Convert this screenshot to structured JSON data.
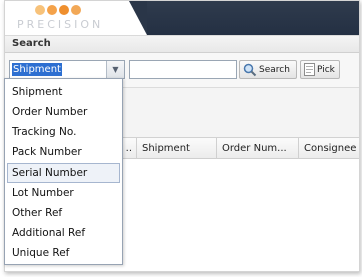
{
  "brand": {
    "logo_text": "PRECISION",
    "dot_colors": [
      "#f7c27a",
      "#f4a24a",
      "#ef8f2e",
      "#f2a857"
    ]
  },
  "search_panel": {
    "title": "Search",
    "type_select": {
      "value": "Shipment"
    },
    "query_input": {
      "value": "",
      "placeholder": ""
    },
    "search_button_label": "Search",
    "pick_button_label": "Pick"
  },
  "dropdown": {
    "options": [
      "Shipment",
      "Order Number",
      "Tracking No.",
      "Pack Number",
      "Serial Number",
      "Lot Number",
      "Other Ref",
      "Additional Ref",
      "Unique Ref"
    ],
    "hovered": "Serial Number"
  },
  "grid": {
    "columns": [
      "..",
      "Shipment",
      "Order Num...",
      "Consignee"
    ]
  },
  "colors": {
    "header_dark": "#2f3b4d",
    "selection": "#2d6fd1",
    "hover_border": "#a6b6cf"
  },
  "icons": {
    "search": "magnifier-icon",
    "pick": "document-icon",
    "dropdown_trigger": "chevron-down-icon"
  }
}
